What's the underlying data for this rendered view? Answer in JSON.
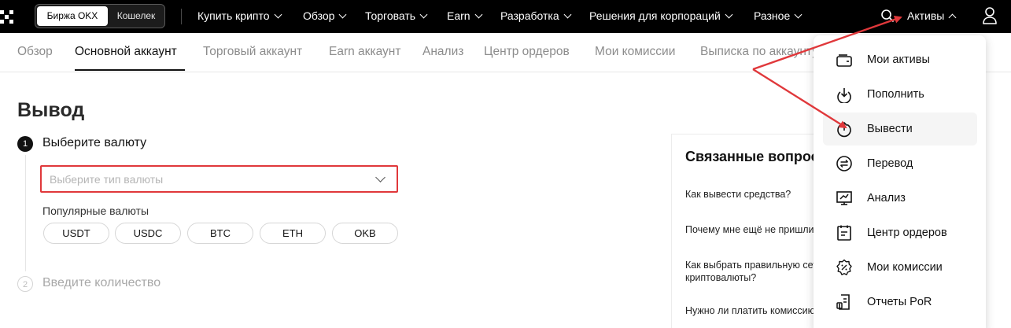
{
  "topbar": {
    "segment": {
      "exchange": "Биржа OKX",
      "wallet": "Кошелек"
    },
    "nav": [
      {
        "label": "Купить крипто"
      },
      {
        "label": "Обзор"
      },
      {
        "label": "Торговать"
      },
      {
        "label": "Earn"
      },
      {
        "label": "Разработка"
      },
      {
        "label": "Решения для корпораций"
      },
      {
        "label": "Разное"
      }
    ],
    "assets_label": "Активы",
    "icons": [
      "okx-logo-icon",
      "search-icon",
      "user-icon"
    ]
  },
  "subnav": {
    "tabs": [
      {
        "label": "Обзор",
        "active": false
      },
      {
        "label": "Основной аккаунт",
        "active": true
      },
      {
        "label": "Торговый аккаунт",
        "active": false
      },
      {
        "label": "Earn аккаунт",
        "active": false
      },
      {
        "label": "Анализ",
        "active": false
      },
      {
        "label": "Центр ордеров",
        "active": false
      },
      {
        "label": "Мои комиссии",
        "active": false
      },
      {
        "label": "Выписка по аккаунту",
        "active": false
      }
    ]
  },
  "main": {
    "title": "Вывод",
    "step1": {
      "number": "1",
      "label": "Выберите валюту"
    },
    "currency_select": {
      "placeholder": "Выберите тип валюты"
    },
    "popular": {
      "label": "Популярные валюты",
      "coins": [
        "USDT",
        "USDC",
        "BTC",
        "ETH",
        "OKB"
      ]
    },
    "step2": {
      "number": "2",
      "label": "Введите количество"
    }
  },
  "related": {
    "title": "Связанные вопросы",
    "questions": [
      "Как вывести средства?",
      "Почему мне ещё не пришли",
      "Как выбрать правильную сеть",
      "криптовалюты?",
      "Нужно ли платить комиссию"
    ]
  },
  "assets_menu": {
    "items": [
      {
        "label": "Мои активы",
        "icon": "wallet-icon"
      },
      {
        "label": "Пополнить",
        "icon": "deposit-icon"
      },
      {
        "label": "Вывести",
        "icon": "withdraw-icon",
        "highlighted": true
      },
      {
        "label": "Перевод",
        "icon": "transfer-icon"
      },
      {
        "label": "Анализ",
        "icon": "analysis-icon"
      },
      {
        "label": "Центр ордеров",
        "icon": "orders-icon"
      },
      {
        "label": "Мои комиссии",
        "icon": "fees-icon"
      },
      {
        "label": "Отчеты PoR",
        "icon": "por-report-icon"
      }
    ]
  },
  "colors": {
    "topbar_bg": "#000000",
    "highlight_border": "#e0383b",
    "annotation_arrow": "#e0383b",
    "menu_hover": "#f5f5f5"
  }
}
